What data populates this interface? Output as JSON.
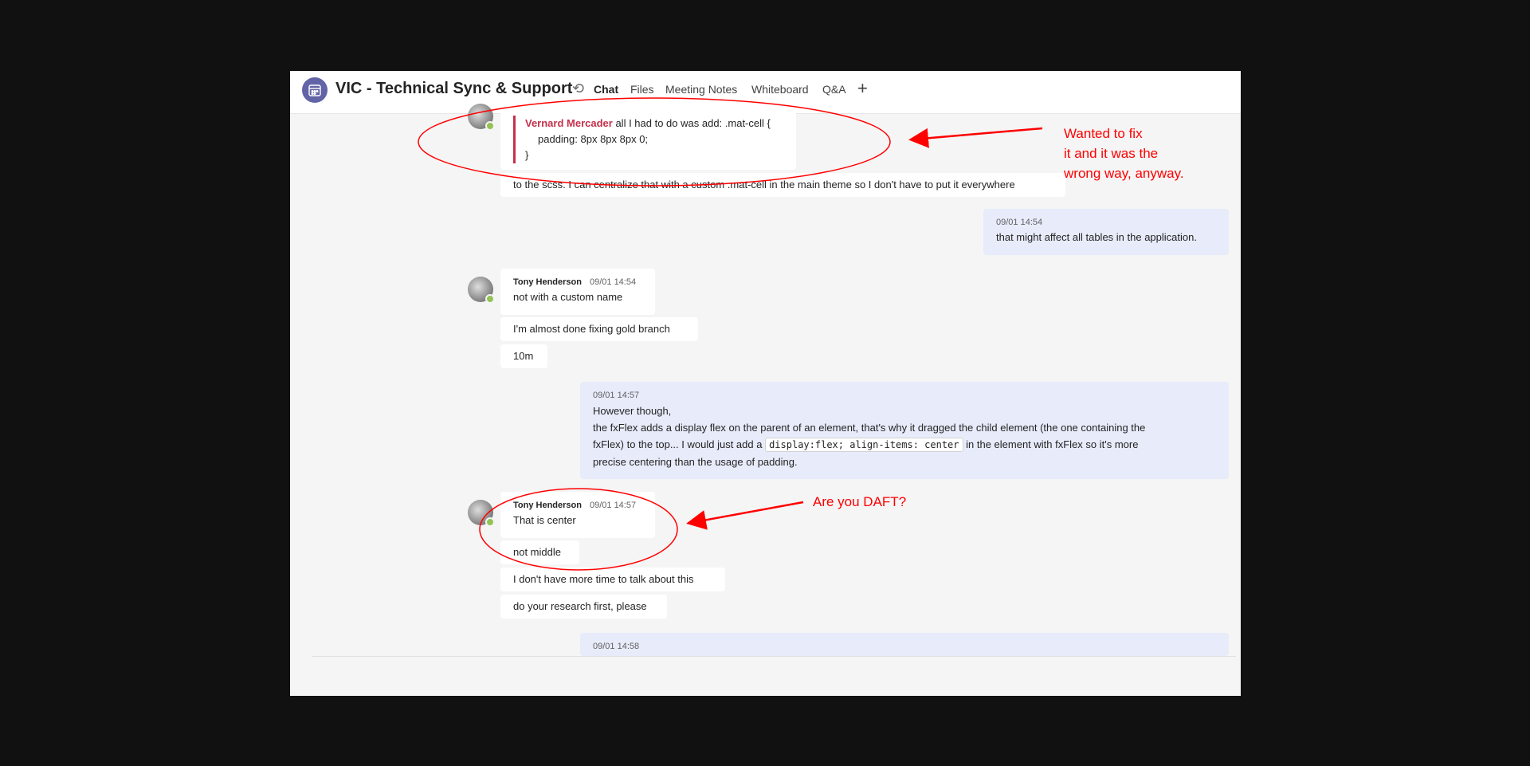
{
  "header": {
    "title": "VIC - Technical Sync & Support",
    "tabs": [
      "Chat",
      "Files",
      "Meeting Notes",
      "Whiteboard",
      "Q&A"
    ],
    "active_tab": "Chat"
  },
  "messages": {
    "quoted": {
      "quote_name": "Vernard Mercader",
      "quote_line1": " all I had to do was add: .mat-cell {",
      "quote_line2": "padding: 8px 8px 8px 0;",
      "quote_line3": "}",
      "text": "to the scss. I can centralize that with a custom .mat-cell in the main theme so I don't have to put it everywhere"
    },
    "m1": {
      "time": "09/01 14:54",
      "text": "that might affect all tables in the application."
    },
    "m2": {
      "name": "Tony Henderson",
      "time": "09/01 14:54",
      "text": "not with a custom name"
    },
    "m3": {
      "text": "I'm almost done fixing gold branch"
    },
    "m4": {
      "text": "10m"
    },
    "m5": {
      "time": "09/01 14:57",
      "line1": "However though,",
      "line2": "the fxFlex adds a display flex on the parent of an element, that's why it dragged the child element (the one containing the",
      "line3a": "fxFlex) to the top... I would just add a",
      "code": "display:flex; align-items: center",
      "line3b": "in the element with fxFlex so it's more",
      "line4": "precise centering than the usage of padding."
    },
    "m6": {
      "name": "Tony Henderson",
      "time": "09/01 14:57",
      "text": "That is center"
    },
    "m7": {
      "text": "not middle"
    },
    "m8": {
      "text": "I don't have more time to talk about this"
    },
    "m9": {
      "text": "do your research first, please"
    },
    "m10": {
      "time": "09/01 14:58"
    }
  },
  "annotations": {
    "top_line1": "Wanted to fix",
    "top_line2": "it and it was the",
    "top_line3": "wrong way, anyway.",
    "bottom": "Are you DAFT?"
  },
  "colors": {
    "annotation": "#ff0000",
    "accent": "#6264a7",
    "mine_bubble": "#e8ebfa",
    "quote_name": "#c4314b",
    "presence": "#92c353"
  },
  "icons": [
    "calendar-icon",
    "sync-icon",
    "add-tab-icon",
    "presence-available-icon"
  ]
}
